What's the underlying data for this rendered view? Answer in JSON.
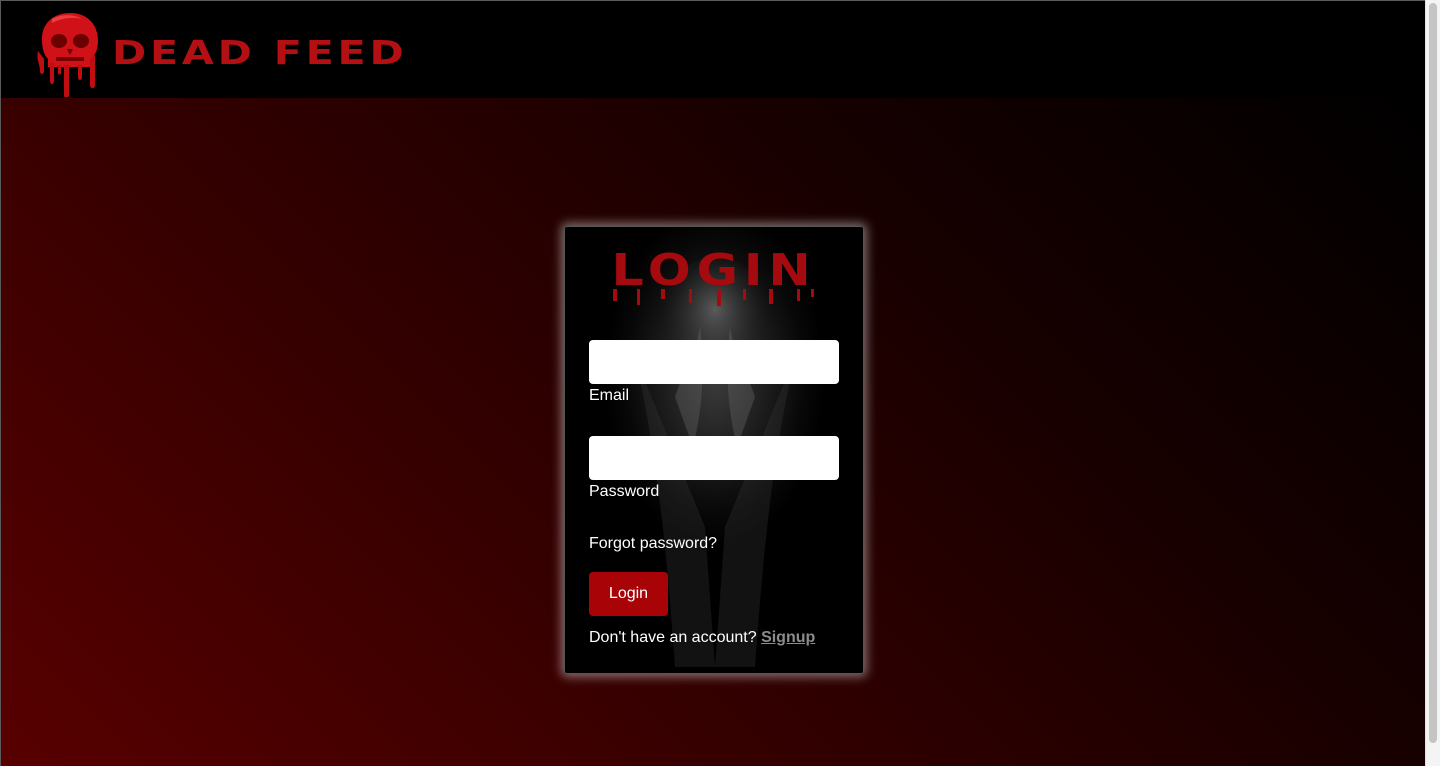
{
  "navbar": {
    "brand_name": "DEAD FEED",
    "logo_icon": "bloody-skull-icon"
  },
  "login_card": {
    "title": "LOGIN",
    "email_label": "Email",
    "email_value": "",
    "password_label": "Password",
    "password_value": "",
    "forgot_password": "Forgot password?",
    "login_button": "Login",
    "signup_prompt": "Don't have an account?",
    "signup_link": "Signup"
  },
  "colors": {
    "brand_red": "#b40f13",
    "button_red": "#a80408",
    "navbar_bg": "#000000",
    "background_gradient_end": "#580000"
  }
}
